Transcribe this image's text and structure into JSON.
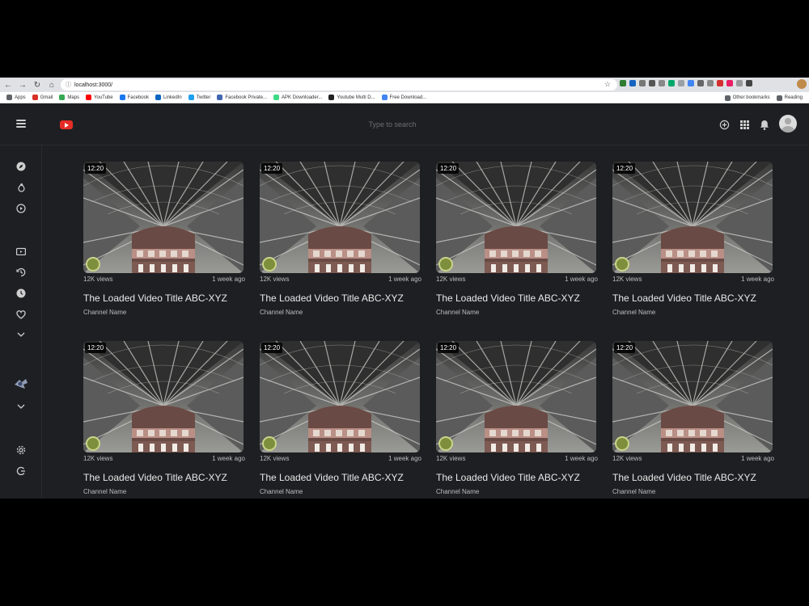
{
  "browser": {
    "url": "localhost:3000/",
    "bookmarks": [
      {
        "label": "Apps",
        "icon": "apps-grid-icon",
        "color": "#5f6368"
      },
      {
        "label": "Gmail",
        "icon": "gmail-icon",
        "color": "#d93025"
      },
      {
        "label": "Maps",
        "icon": "maps-icon",
        "color": "#34a853"
      },
      {
        "label": "YouTube",
        "icon": "youtube-icon",
        "color": "#ff0000"
      },
      {
        "label": "Facebook",
        "icon": "facebook-icon",
        "color": "#1877f2"
      },
      {
        "label": "LinkedIn",
        "icon": "linkedin-icon",
        "color": "#0a66c2"
      },
      {
        "label": "Twitter",
        "icon": "twitter-icon",
        "color": "#1da1f2"
      },
      {
        "label": "Facebook Private...",
        "icon": "facebook-private-icon",
        "color": "#4267b2"
      },
      {
        "label": "APK Downloader...",
        "icon": "apk-icon",
        "color": "#3ddc84"
      },
      {
        "label": "Youtube Multi D...",
        "icon": "youtube-multi-icon",
        "color": "#222222"
      },
      {
        "label": "Free Download...",
        "icon": "free-download-icon",
        "color": "#4285f4"
      }
    ],
    "other_bookmarks": "Other bookmarks",
    "reading_list": "Reading"
  },
  "app": {
    "search_placeholder": "Type to search",
    "accent": "#e52d27"
  },
  "videos": [
    {
      "duration": "12:20",
      "views": "12K views",
      "time": "1 week ago",
      "title": "The Loaded Video Title ABC-XYZ",
      "channel": "Channel Name"
    },
    {
      "duration": "12:20",
      "views": "12K views",
      "time": "1 week ago",
      "title": "The Loaded Video Title ABC-XYZ",
      "channel": "Channel Name"
    },
    {
      "duration": "12:20",
      "views": "12K views",
      "time": "1 week ago",
      "title": "The Loaded Video Title ABC-XYZ",
      "channel": "Channel Name"
    },
    {
      "duration": "12:20",
      "views": "12K views",
      "time": "1 week ago",
      "title": "The Loaded Video Title ABC-XYZ",
      "channel": "Channel Name"
    },
    {
      "duration": "12:20",
      "views": "12K views",
      "time": "1 week ago",
      "title": "The Loaded Video Title ABC-XYZ",
      "channel": "Channel Name"
    },
    {
      "duration": "12:20",
      "views": "12K views",
      "time": "1 week ago",
      "title": "The Loaded Video Title ABC-XYZ",
      "channel": "Channel Name"
    },
    {
      "duration": "12:20",
      "views": "12K views",
      "time": "1 week ago",
      "title": "The Loaded Video Title ABC-XYZ",
      "channel": "Channel Name"
    },
    {
      "duration": "12:20",
      "views": "12K views",
      "time": "1 week ago",
      "title": "The Loaded Video Title ABC-XYZ",
      "channel": "Channel Name"
    }
  ]
}
